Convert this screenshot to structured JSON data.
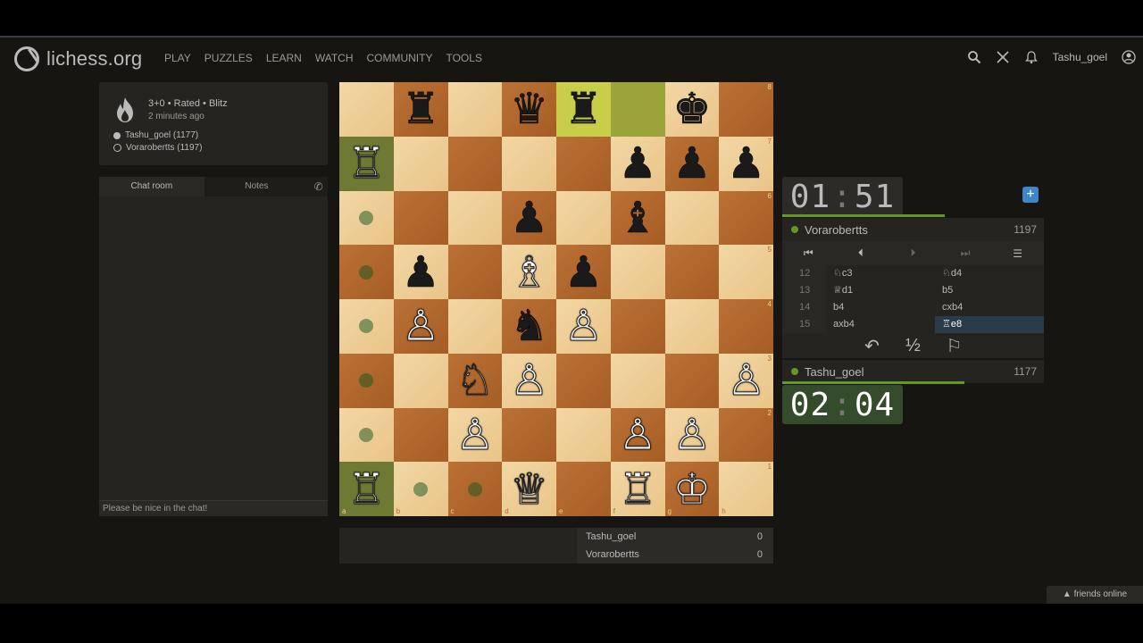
{
  "header": {
    "logo_text": "lichess.org",
    "nav": [
      "PLAY",
      "PUZZLES",
      "LEARN",
      "WATCH",
      "COMMUNITY",
      "TOOLS"
    ],
    "username": "Tashu_goel"
  },
  "game_info": {
    "line1": "3+0 • Rated • Blitz",
    "line2": "2 minutes ago",
    "white_player": "Tashu_goel (1177)",
    "black_player": "Vorarobertts (1197)"
  },
  "chat": {
    "tab_chat": "Chat room",
    "tab_notes": "Notes",
    "placeholder": "Please be nice in the chat!"
  },
  "board": {
    "files": [
      "a",
      "b",
      "c",
      "d",
      "e",
      "f",
      "g",
      "h"
    ],
    "ranks": [
      "8",
      "7",
      "6",
      "5",
      "4",
      "3",
      "2",
      "1"
    ],
    "pieces": [
      [
        "",
        "♜",
        "",
        "♛",
        "♜",
        "",
        "♚",
        ""
      ],
      [
        "♖",
        "",
        "",
        "",
        "",
        "♟",
        "♟",
        "♟"
      ],
      [
        "",
        "",
        "",
        "♟",
        "",
        "♝",
        "",
        ""
      ],
      [
        "",
        "♟",
        "",
        "♗",
        "♟",
        "",
        "",
        ""
      ],
      [
        "",
        "♙",
        "",
        "♞",
        "♙",
        "",
        "",
        ""
      ],
      [
        "",
        "",
        "♘",
        "♙",
        "",
        "",
        "",
        "♙"
      ],
      [
        "",
        "",
        "♙",
        "",
        "",
        "♙",
        "♙",
        ""
      ],
      [
        "♖",
        "",
        "",
        "♕",
        "",
        "♖",
        "♔",
        ""
      ]
    ],
    "colors": [
      [
        "",
        "b",
        "",
        "b",
        "b",
        "",
        "b",
        ""
      ],
      [
        "w",
        "",
        "",
        "",
        "",
        "b",
        "b",
        "b"
      ],
      [
        "",
        "",
        "",
        "b",
        "",
        "b",
        "",
        ""
      ],
      [
        "",
        "b",
        "",
        "w",
        "b",
        "",
        "",
        ""
      ],
      [
        "",
        "w",
        "",
        "b",
        "w",
        "",
        "",
        ""
      ],
      [
        "",
        "",
        "w",
        "w",
        "",
        "",
        "",
        "w"
      ],
      [
        "",
        "",
        "w",
        "",
        "",
        "w",
        "w",
        ""
      ],
      [
        "w",
        "",
        "",
        "w",
        "",
        "w",
        "w",
        ""
      ]
    ]
  },
  "crosstable": {
    "p1": "Tashu_goel",
    "s1": "0",
    "p2": "Vorarobertts",
    "s2": "0"
  },
  "clocks": {
    "top_min": "01",
    "top_sec": "51",
    "bottom_min": "02",
    "bottom_sec": "04"
  },
  "players": {
    "top_name": "Vorarobertts",
    "top_rating": "1197",
    "bottom_name": "Tashu_goel",
    "bottom_rating": "1177"
  },
  "moves": [
    {
      "n": "12",
      "w": "♘c3",
      "b": "♘d4"
    },
    {
      "n": "13",
      "w": "♕d1",
      "b": "b5"
    },
    {
      "n": "14",
      "w": "b4",
      "b": "cxb4"
    },
    {
      "n": "15",
      "w": "axb4",
      "b": "♖e8"
    }
  ],
  "friends": "▲ friends online"
}
